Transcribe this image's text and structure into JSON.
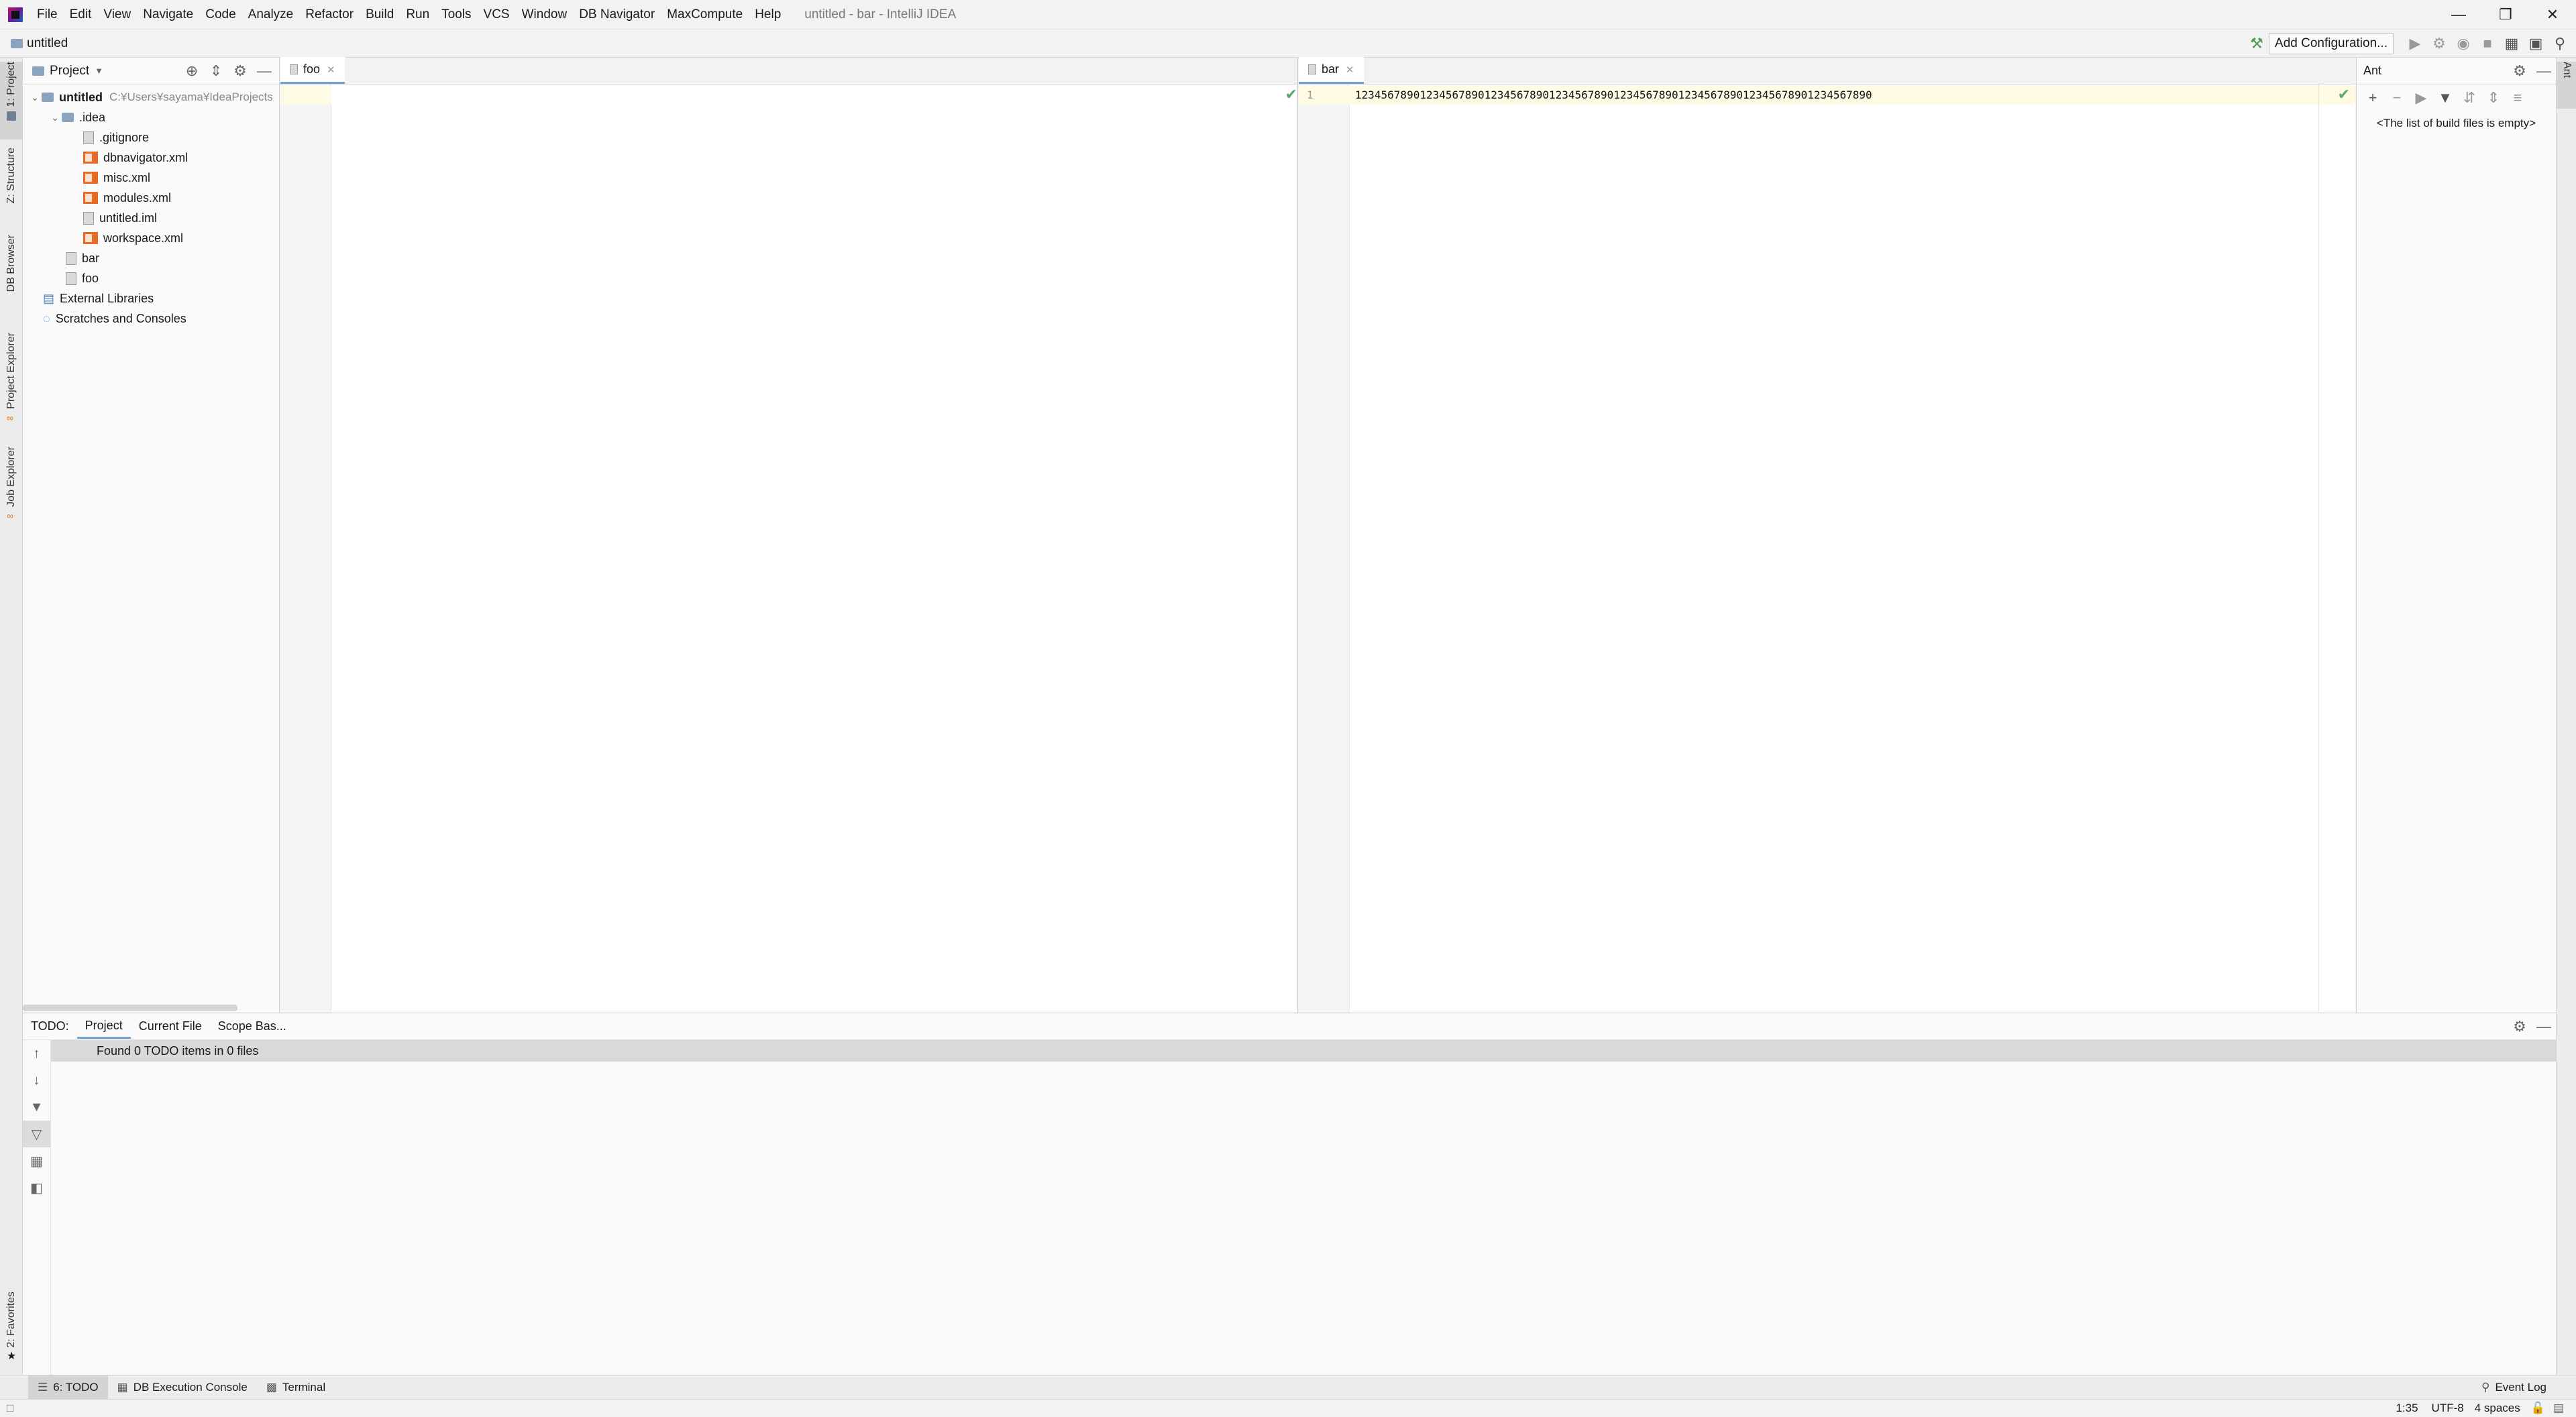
{
  "app": {
    "window_title": "untitled - bar - IntelliJ IDEA",
    "menu": [
      "File",
      "Edit",
      "View",
      "Navigate",
      "Code",
      "Analyze",
      "Refactor",
      "Build",
      "Run",
      "Tools",
      "VCS",
      "Window",
      "DB Navigator",
      "MaxCompute",
      "Help"
    ]
  },
  "navbar": {
    "breadcrumb": "untitled",
    "add_configuration": "Add Configuration..."
  },
  "left_stripe": [
    "1: Project",
    "Z: Structure",
    "DB Browser",
    "Project Explorer",
    "Job Explorer",
    "2: Favorites"
  ],
  "right_stripe": [
    "Ant"
  ],
  "project_panel": {
    "title": "Project",
    "tree": {
      "root_name": "untitled",
      "root_path": "C:¥Users¥sayama¥IdeaProjects",
      "idea_folder": ".idea",
      "idea_files": [
        ".gitignore",
        "dbnavigator.xml",
        "misc.xml",
        "modules.xml",
        "untitled.iml",
        "workspace.xml"
      ],
      "files": [
        "bar",
        "foo"
      ],
      "external_libraries": "External Libraries",
      "scratches": "Scratches and Consoles"
    }
  },
  "editor_left": {
    "tab": "foo"
  },
  "editor_right": {
    "tab": "bar",
    "line_number": "1",
    "line_text": "12345678901234567890123456789012345678901234567890123456789012345678901234567890"
  },
  "ant_panel": {
    "title": "Ant",
    "empty_text": "<The list of build files is empty>"
  },
  "todo_panel": {
    "tabs": [
      "TODO:",
      "Project",
      "Current File",
      "Scope Bas..."
    ],
    "active_tab": "Project",
    "result": "Found 0 TODO items in 0 files"
  },
  "tool_strip": {
    "left": [
      "6: TODO",
      "DB Execution Console",
      "Terminal"
    ],
    "right": "Event Log"
  },
  "status_bar": {
    "position": "1:35",
    "encoding": "UTF-8",
    "indent": "4 spaces"
  },
  "colors": {
    "accent": "#6fa1d6",
    "ok_check": "#59a869",
    "current_line": "#fffae3"
  }
}
